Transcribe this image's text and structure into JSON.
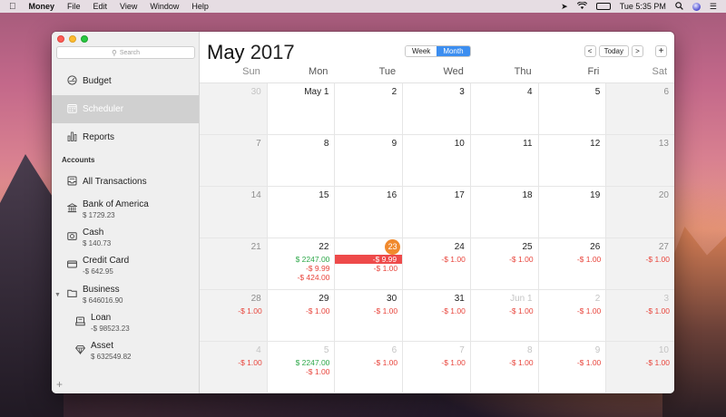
{
  "menubar": {
    "apple": "",
    "app_name": "Money",
    "menus": [
      "File",
      "Edit",
      "View",
      "Window",
      "Help"
    ],
    "battery_label": "🔋",
    "clock": "Tue 5:35 PM"
  },
  "sidebar": {
    "search_placeholder": "Search",
    "nav": [
      {
        "label": "Budget",
        "icon": "budget-gauge-icon"
      },
      {
        "label": "Scheduler",
        "icon": "calendar-icon",
        "selected": true
      },
      {
        "label": "Reports",
        "icon": "bar-chart-icon"
      }
    ],
    "accounts_header": "Accounts",
    "all_transactions": "All Transactions",
    "accounts": [
      {
        "name": "Bank of America",
        "balance": "$ 1729.23",
        "icon": "bank-icon"
      },
      {
        "name": "Cash",
        "balance": "$ 140.73",
        "icon": "cash-icon"
      },
      {
        "name": "Credit Card",
        "balance": "-$ 642.95",
        "icon": "credit-card-icon"
      },
      {
        "name": "Business",
        "balance": "$ 646016.90",
        "icon": "folder-icon"
      },
      {
        "name": "Loan",
        "balance": "-$ 98523.23",
        "icon": "loan-icon"
      },
      {
        "name": "Asset",
        "balance": "$ 632549.82",
        "icon": "diamond-icon"
      }
    ]
  },
  "calendar": {
    "month": "May",
    "year": "2017",
    "view_week": "Week",
    "view_month": "Month",
    "today_button": "Today",
    "prev": "<",
    "next": ">",
    "add": "+",
    "days_of_week": [
      "Sun",
      "Mon",
      "Tue",
      "Wed",
      "Thu",
      "Fri",
      "Sat"
    ],
    "weeks": [
      [
        {
          "day": "30",
          "out": true,
          "txns": []
        },
        {
          "day": "May 1",
          "txns": []
        },
        {
          "day": "2",
          "txns": []
        },
        {
          "day": "3",
          "txns": []
        },
        {
          "day": "4",
          "txns": []
        },
        {
          "day": "5",
          "txns": []
        },
        {
          "day": "6",
          "txns": []
        }
      ],
      [
        {
          "day": "7",
          "txns": []
        },
        {
          "day": "8",
          "txns": []
        },
        {
          "day": "9",
          "txns": []
        },
        {
          "day": "10",
          "txns": []
        },
        {
          "day": "11",
          "txns": []
        },
        {
          "day": "12",
          "txns": []
        },
        {
          "day": "13",
          "txns": []
        }
      ],
      [
        {
          "day": "14",
          "txns": []
        },
        {
          "day": "15",
          "txns": []
        },
        {
          "day": "16",
          "txns": []
        },
        {
          "day": "17",
          "txns": []
        },
        {
          "day": "18",
          "txns": []
        },
        {
          "day": "19",
          "txns": []
        },
        {
          "day": "20",
          "txns": []
        }
      ],
      [
        {
          "day": "21",
          "txns": []
        },
        {
          "day": "22",
          "txns": [
            {
              "amount": "$ 2247.00",
              "type": "pos"
            },
            {
              "amount": "-$ 9.99",
              "type": "neg"
            },
            {
              "amount": "-$ 424.00",
              "type": "neg"
            }
          ]
        },
        {
          "day": "23",
          "today": true,
          "txns": [
            {
              "amount": "-$ 9.99",
              "type": "hl"
            },
            {
              "amount": "-$ 1.00",
              "type": "neg"
            }
          ]
        },
        {
          "day": "24",
          "txns": [
            {
              "amount": "-$ 1.00",
              "type": "neg"
            }
          ]
        },
        {
          "day": "25",
          "txns": [
            {
              "amount": "-$ 1.00",
              "type": "neg"
            }
          ]
        },
        {
          "day": "26",
          "txns": [
            {
              "amount": "-$ 1.00",
              "type": "neg"
            }
          ]
        },
        {
          "day": "27",
          "txns": [
            {
              "amount": "-$ 1.00",
              "type": "neg"
            }
          ]
        }
      ],
      [
        {
          "day": "28",
          "txns": [
            {
              "amount": "-$ 1.00",
              "type": "neg"
            }
          ]
        },
        {
          "day": "29",
          "txns": [
            {
              "amount": "-$ 1.00",
              "type": "neg"
            }
          ]
        },
        {
          "day": "30",
          "txns": [
            {
              "amount": "-$ 1.00",
              "type": "neg"
            }
          ]
        },
        {
          "day": "31",
          "txns": [
            {
              "amount": "-$ 1.00",
              "type": "neg"
            }
          ]
        },
        {
          "day": "Jun 1",
          "out": true,
          "txns": [
            {
              "amount": "-$ 1.00",
              "type": "neg"
            }
          ]
        },
        {
          "day": "2",
          "out": true,
          "txns": [
            {
              "amount": "-$ 1.00",
              "type": "neg"
            }
          ]
        },
        {
          "day": "3",
          "out": true,
          "txns": [
            {
              "amount": "-$ 1.00",
              "type": "neg"
            }
          ]
        }
      ],
      [
        {
          "day": "4",
          "out": true,
          "txns": [
            {
              "amount": "-$ 1.00",
              "type": "neg"
            }
          ]
        },
        {
          "day": "5",
          "out": true,
          "txns": [
            {
              "amount": "$ 2247.00",
              "type": "pos"
            },
            {
              "amount": "-$ 1.00",
              "type": "neg"
            }
          ]
        },
        {
          "day": "6",
          "out": true,
          "txns": [
            {
              "amount": "-$ 1.00",
              "type": "neg"
            }
          ]
        },
        {
          "day": "7",
          "out": true,
          "txns": [
            {
              "amount": "-$ 1.00",
              "type": "neg"
            }
          ]
        },
        {
          "day": "8",
          "out": true,
          "txns": [
            {
              "amount": "-$ 1.00",
              "type": "neg"
            }
          ]
        },
        {
          "day": "9",
          "out": true,
          "txns": [
            {
              "amount": "-$ 1.00",
              "type": "neg"
            }
          ]
        },
        {
          "day": "10",
          "out": true,
          "txns": [
            {
              "amount": "-$ 1.00",
              "type": "neg"
            }
          ]
        }
      ]
    ]
  },
  "colors": {
    "accent": "#3c8ef0",
    "today": "#f08a2e",
    "negative": "#e8453c",
    "positive": "#2ea84a",
    "highlight": "#ee4a4a"
  }
}
